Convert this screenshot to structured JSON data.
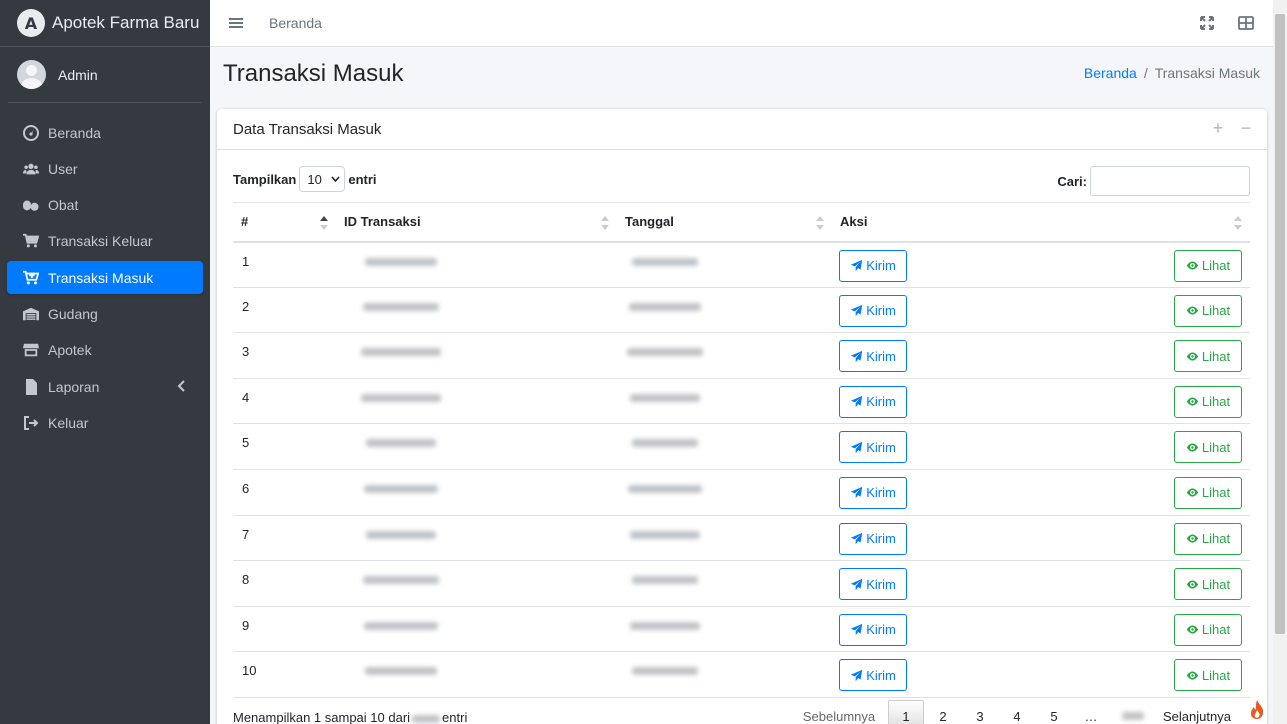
{
  "brand": {
    "logo_letter": "A",
    "name": "Apotek Farma Baru"
  },
  "user": {
    "name": "Admin"
  },
  "sidebar": {
    "items": [
      {
        "label": "Beranda",
        "icon": "tachometer-icon"
      },
      {
        "label": "User",
        "icon": "users-icon"
      },
      {
        "label": "Obat",
        "icon": "pills-icon"
      },
      {
        "label": "Transaksi Keluar",
        "icon": "cart-icon"
      },
      {
        "label": "Transaksi Masuk",
        "icon": "cart-plus-icon",
        "active": true
      },
      {
        "label": "Gudang",
        "icon": "warehouse-icon"
      },
      {
        "label": "Apotek",
        "icon": "store-icon"
      },
      {
        "label": "Laporan",
        "icon": "file-icon"
      },
      {
        "label": "Keluar",
        "icon": "sign-out-icon"
      }
    ]
  },
  "topbar": {
    "link": "Beranda"
  },
  "page": {
    "title": "Transaksi Masuk",
    "breadcrumb": {
      "home": "Beranda",
      "separator": "/",
      "current": "Transaksi Masuk"
    }
  },
  "card": {
    "title": "Data Transaksi Masuk",
    "length": {
      "prefix": "Tampilkan",
      "value": "10",
      "suffix": "entri"
    },
    "search_label": "Cari:",
    "table": {
      "headers": [
        "#",
        "ID Transaksi",
        "Tanggal",
        "Aksi"
      ],
      "rows": [
        {
          "no": "1"
        },
        {
          "no": "2"
        },
        {
          "no": "3"
        },
        {
          "no": "4"
        },
        {
          "no": "5"
        },
        {
          "no": "6"
        },
        {
          "no": "7"
        },
        {
          "no": "8"
        },
        {
          "no": "9"
        },
        {
          "no": "10"
        }
      ],
      "btn_kirim": "Kirim",
      "btn_lihat": "Lihat"
    },
    "info": {
      "prefix": "Menampilkan 1 sampai 10 dari",
      "suffix": "entri"
    },
    "pagination": {
      "prev": "Sebelumnya",
      "pages": [
        "1",
        "2",
        "3",
        "4",
        "5"
      ],
      "ellipsis": "…",
      "next": "Selanjutnya"
    }
  },
  "colors": {
    "sidebar_bg": "#343a40",
    "primary": "#007bff",
    "success": "#28a745"
  }
}
